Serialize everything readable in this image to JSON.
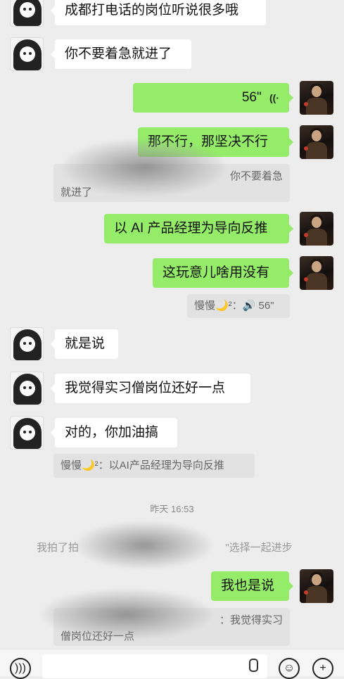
{
  "messages": {
    "m1": "成都打电话的岗位听说很多哦",
    "m2": "你不要着急就进了",
    "m3_duration": "56\"",
    "m4": "那不行，那坚决不行",
    "q1_visible": "你不要着急",
    "q1_line2": "就进了",
    "m5": "以 AI 产品经理为导向反推",
    "m6": "这玩意儿啥用没有",
    "q2": "慢慢🌙²：🔊 56\"",
    "m7": "就是说",
    "m8": "我觉得实习僧岗位还好一点",
    "m9": "对的，你加油搞",
    "q3": "慢慢🌙²：以AI产品经理为导向反推",
    "time": "昨天 16:53",
    "sys_left": "我拍了拍",
    "sys_right": "\"选择一起进步",
    "m10": "我也是说",
    "q4_right": "：我觉得实习",
    "q4_line2": "僧岗位还好一点"
  },
  "icons": {
    "voice_wave": "voice-wave-icon",
    "microphone": "microphone-icon",
    "emoji": "emoji-icon",
    "plus": "plus-icon"
  },
  "colors": {
    "background": "#ededed",
    "bubble_self": "#95ec69",
    "bubble_other": "#ffffff"
  }
}
